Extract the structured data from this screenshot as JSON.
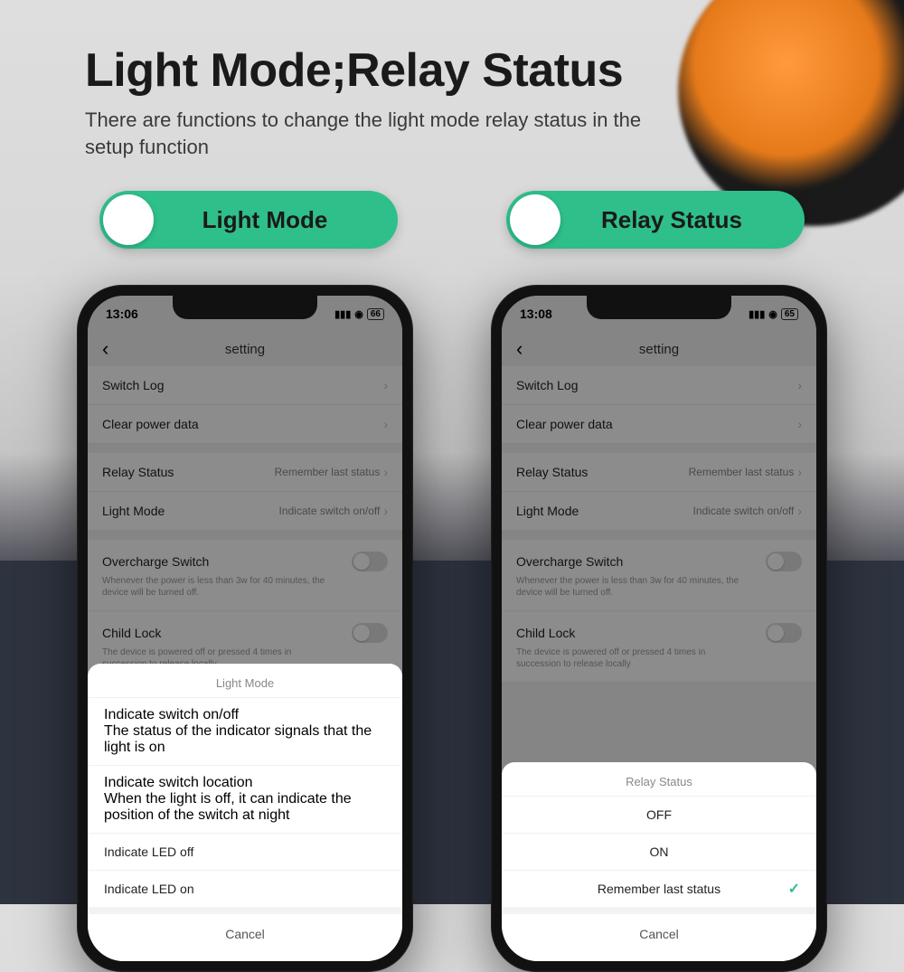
{
  "header": {
    "title": "Light Mode;Relay Status",
    "subtitle": "There are functions to change the light mode relay status in the setup function"
  },
  "pills": {
    "left": "Light Mode",
    "right": "Relay Status"
  },
  "phoneA": {
    "time": "13:06",
    "battery": "66",
    "navTitle": "setting",
    "rows": {
      "switchLog": "Switch Log",
      "clearPower": "Clear power data",
      "relayStatus": "Relay Status",
      "relayStatusValue": "Remember last status",
      "lightMode": "Light Mode",
      "lightModeValue": "Indicate switch on/off",
      "overcharge": "Overcharge Switch",
      "overchargeDesc": "Whenever the power is less than 3w for 40 minutes, the device will be turned off.",
      "childLock": "Child Lock",
      "childLockDesc": "The device is powered off or pressed 4 times in succession to release locally"
    },
    "sheet": {
      "title": "Light Mode",
      "opt1": "Indicate switch on/off",
      "opt1desc": "The status of the indicator signals that the light is on",
      "opt2": "Indicate switch location",
      "opt2desc": "When the light is off, it can indicate the position of the switch at night",
      "opt3": "Indicate LED off",
      "opt4": "Indicate LED on",
      "cancel": "Cancel"
    }
  },
  "phoneB": {
    "time": "13:08",
    "battery": "65",
    "navTitle": "setting",
    "sheet": {
      "title": "Relay Status",
      "opt1": "OFF",
      "opt2": "ON",
      "opt3": "Remember last status",
      "cancel": "Cancel"
    }
  }
}
